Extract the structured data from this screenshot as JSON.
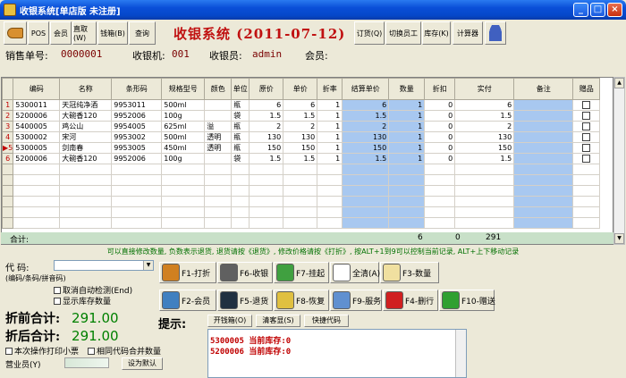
{
  "window": {
    "title": "收银系统[单店版 未注册]",
    "minimize": "_",
    "maximize": "□",
    "close": "×"
  },
  "toolbar": {
    "buttons": [
      "",
      "POS",
      "会员",
      "直取(W)",
      "钱箱(B)",
      "查询"
    ],
    "title": "收银系统  (2011-07-12)",
    "right_buttons": [
      "订货(Q)",
      "切换员工",
      "库存(K)",
      "计算器"
    ]
  },
  "info": {
    "order_label": "销售单号:",
    "order_no": "0000001",
    "pos_label": "收银机:",
    "pos_no": "001",
    "cashier_label": "收银员:",
    "cashier": "admin",
    "member_label": "会员:"
  },
  "table": {
    "headers": [
      "编码",
      "名称",
      "条形码",
      "规格型号",
      "颜色",
      "单位",
      "原价",
      "单价",
      "折率",
      "结算单价",
      "数量",
      "折扣",
      "实付",
      "备注",
      "赠品"
    ],
    "rows": [
      {
        "mark": "1",
        "code": "5300011",
        "name": "天冠纯净酒",
        "barcode": "9953011",
        "spec": "500ml",
        "color": "",
        "unit": "瓶",
        "orig": "6",
        "price": "6",
        "rate": "1",
        "settle": "6",
        "qty": "1",
        "disc": "0",
        "paid": "6"
      },
      {
        "mark": "2",
        "code": "5200006",
        "name": "大碗香120",
        "barcode": "9952006",
        "spec": "100g",
        "color": "",
        "unit": "袋",
        "orig": "1.5",
        "price": "1.5",
        "rate": "1",
        "settle": "1.5",
        "qty": "1",
        "disc": "0",
        "paid": "1.5"
      },
      {
        "mark": "3",
        "code": "5400005",
        "name": "鸡公山",
        "barcode": "9954005",
        "spec": "625ml",
        "color": "溢",
        "unit": "瓶",
        "orig": "2",
        "price": "2",
        "rate": "1",
        "settle": "2",
        "qty": "1",
        "disc": "0",
        "paid": "2"
      },
      {
        "mark": "4",
        "code": "5300002",
        "name": "宋河",
        "barcode": "9953002",
        "spec": "500ml",
        "color": "透明",
        "unit": "瓶",
        "orig": "130",
        "price": "130",
        "rate": "1",
        "settle": "130",
        "qty": "1",
        "disc": "0",
        "paid": "130"
      },
      {
        "mark": "▶5",
        "code": "5300005",
        "name": "剑南春",
        "barcode": "9953005",
        "spec": "450ml",
        "color": "透明",
        "unit": "瓶",
        "orig": "150",
        "price": "150",
        "rate": "1",
        "settle": "150",
        "qty": "1",
        "disc": "0",
        "paid": "150"
      },
      {
        "mark": "6",
        "code": "5200006",
        "name": "大碗香120",
        "barcode": "9952006",
        "spec": "100g",
        "color": "",
        "unit": "袋",
        "orig": "1.5",
        "price": "1.5",
        "rate": "1",
        "settle": "1.5",
        "qty": "1",
        "disc": "0",
        "paid": "1.5"
      }
    ],
    "total_label": "合计:",
    "total_qty": "6",
    "total_disc": "0",
    "total_paid": "291"
  },
  "hint": "可以直接修改数量, 负数表示退货, 退货请按《退货》, 修改价格请按《打折》, 按ALT+1到9可以控制当前记录, ALT+上下移动记录",
  "code_panel": {
    "code_label": "代  码:",
    "code_hint": "(编码/条码/拼音码)",
    "auto_detect": "取消自动检测(End)",
    "show_stock": "显示库存数量"
  },
  "fkeys": [
    {
      "label": "F1-打折",
      "color": "#d08020"
    },
    {
      "label": "F6-收银",
      "color": "#606060"
    },
    {
      "label": "F7-挂起",
      "color": "#40a040"
    },
    {
      "label": "全清(A)",
      "color": "#ffffff"
    },
    {
      "label": "F3-数量",
      "color": "#f0e0a0"
    },
    {
      "label": "F2-会员",
      "color": "#4080c0"
    },
    {
      "label": "F5-退货",
      "color": "#203040"
    },
    {
      "label": "F8-恢复",
      "color": "#e0c040"
    },
    {
      "label": "F9-服务",
      "color": "#6090d0"
    },
    {
      "label": "F4-删行",
      "color": "#d02020"
    },
    {
      "label": "F10-赠送",
      "color": "#30a030"
    }
  ],
  "totals": {
    "before_label": "折前合计:",
    "before": "291.00",
    "after_label": "折后合计:",
    "after": "291.00"
  },
  "options": {
    "print_receipt": "本次操作打印小票",
    "merge_qty": "相同代码合并数量",
    "operator_label": "营业员(Y)",
    "set_default": "设为默认"
  },
  "prompt": {
    "label": "提示:",
    "buttons": [
      "开钱箱(O)",
      "清客显(S)",
      "快捷代码"
    ],
    "messages": [
      "5300005 当前库存:0",
      "5200006 当前库存:0"
    ]
  }
}
